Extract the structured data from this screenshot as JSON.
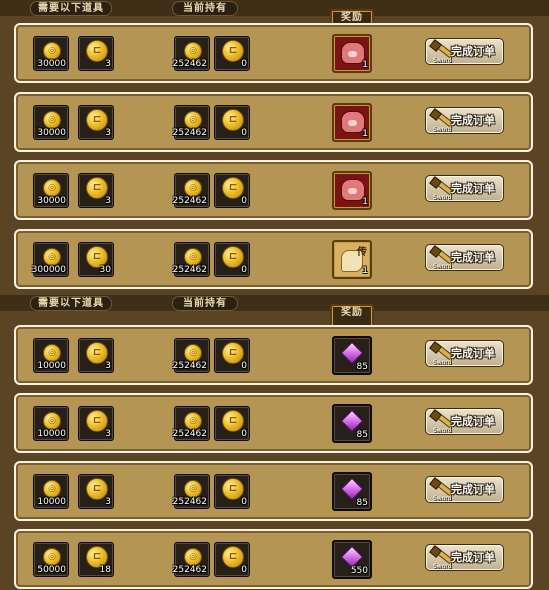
{
  "panels": [
    {
      "headers": {
        "required": "需要以下道具",
        "owned": "当前持有",
        "reward": "奖励"
      },
      "rows": [
        {
          "req_gold": "30000",
          "req_token": "3",
          "own_gold": "252462",
          "own_token": "0",
          "reward_type": "red-bag-icon",
          "reward_count": "1",
          "reward_tag": "",
          "button": "完成订单",
          "button_sub": "Sword"
        },
        {
          "req_gold": "30000",
          "req_token": "3",
          "own_gold": "252462",
          "own_token": "0",
          "reward_type": "red-bag-icon",
          "reward_count": "1",
          "reward_tag": "",
          "button": "完成订单",
          "button_sub": "Sword"
        },
        {
          "req_gold": "30000",
          "req_token": "3",
          "own_gold": "252462",
          "own_token": "0",
          "reward_type": "red-bag-icon",
          "reward_count": "1",
          "reward_tag": "",
          "button": "完成订单",
          "button_sub": "Sword"
        },
        {
          "req_gold": "300000",
          "req_token": "30",
          "own_gold": "252462",
          "own_token": "0",
          "reward_type": "scroll-item-icon",
          "reward_count": "1",
          "reward_tag": "传",
          "button": "完成订单",
          "button_sub": "Sword"
        }
      ]
    },
    {
      "headers": {
        "required": "需要以下道具",
        "owned": "当前持有",
        "reward": "奖励"
      },
      "rows": [
        {
          "req_gold": "10000",
          "req_token": "3",
          "own_gold": "252462",
          "own_token": "0",
          "reward_type": "purple-gem-icon",
          "reward_count": "85",
          "reward_tag": "",
          "button": "完成订单",
          "button_sub": "Sword"
        },
        {
          "req_gold": "10000",
          "req_token": "3",
          "own_gold": "252462",
          "own_token": "0",
          "reward_type": "purple-gem-icon",
          "reward_count": "85",
          "reward_tag": "",
          "button": "完成订单",
          "button_sub": "Sword"
        },
        {
          "req_gold": "10000",
          "req_token": "3",
          "own_gold": "252462",
          "own_token": "0",
          "reward_type": "purple-gem-icon",
          "reward_count": "85",
          "reward_tag": "",
          "button": "完成订单",
          "button_sub": "Sword"
        },
        {
          "req_gold": "50000",
          "req_token": "18",
          "own_gold": "252462",
          "own_token": "0",
          "reward_type": "purple-gem-icon",
          "reward_count": "550",
          "reward_tag": "",
          "button": "完成订单",
          "button_sub": "Sword"
        }
      ]
    }
  ]
}
